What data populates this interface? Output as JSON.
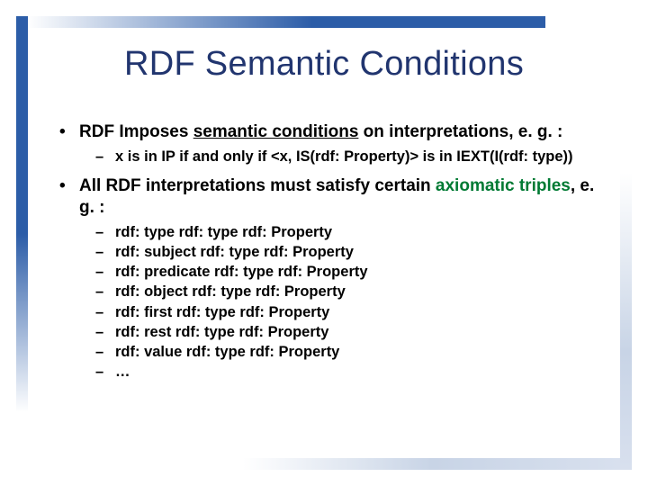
{
  "title": "RDF Semantic Conditions",
  "bullets": {
    "b1_pre": "RDF Imposes ",
    "b1_underline": "semantic conditions",
    "b1_post": " on interpretations, e. g. :",
    "b1_sub": "x is in IP if and only if <x, IS(rdf: Property)> is in IEXT(I(rdf: type))",
    "b2_pre": "All RDF interpretations must satisfy certain ",
    "b2_green": "axiomatic triples",
    "b2_post": ", e. g. :",
    "axioms": [
      "rdf: type rdf: type rdf: Property",
      "rdf: subject rdf: type rdf: Property",
      "rdf: predicate rdf: type rdf: Property",
      "rdf: object rdf: type rdf: Property",
      "rdf: first rdf: type rdf: Property",
      "rdf: rest rdf: type rdf: Property",
      "rdf: value rdf: type rdf: Property",
      "…"
    ]
  }
}
